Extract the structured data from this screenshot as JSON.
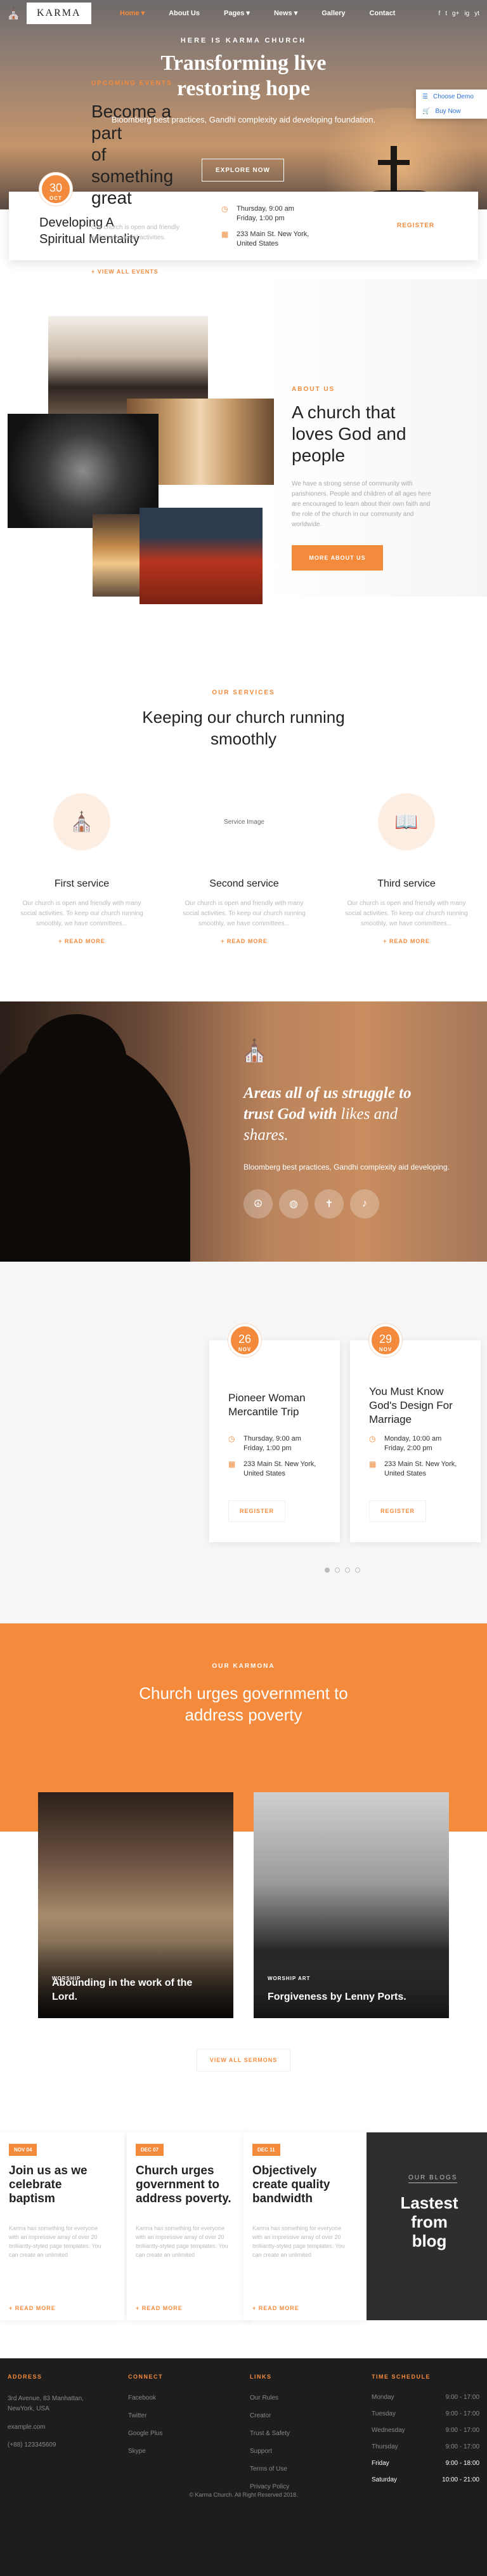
{
  "header": {
    "logo_text": "KARMA",
    "menu": [
      {
        "label": "Home",
        "dropdown": true,
        "active": true
      },
      {
        "label": "About Us",
        "dropdown": false,
        "active": false
      },
      {
        "label": "Pages",
        "dropdown": true,
        "active": false
      },
      {
        "label": "News",
        "dropdown": true,
        "active": false
      },
      {
        "label": "Gallery",
        "dropdown": false,
        "active": false
      },
      {
        "label": "Contact",
        "dropdown": false,
        "active": false
      }
    ],
    "social": [
      "f",
      "t",
      "g+",
      "ig",
      "yt"
    ]
  },
  "hero": {
    "kicker": "HERE IS KARMA CHURCH",
    "title_line1": "Transforming live",
    "title_line2": "restoring hope",
    "subtitle": "Bloomberg best practices, Gandhi complexity aid developing foundation.",
    "button": "EXPLORE NOW"
  },
  "demo_panel": {
    "choose": "Choose Demo",
    "buy": "Buy Now"
  },
  "featured_event": {
    "day": "30",
    "month": "OCT",
    "title_line1": "Developing A",
    "title_line2": "Spiritual Mentality",
    "date_line1": "Thursday, 9:00 am",
    "date_line2": "Friday, 1:00 pm",
    "address_line1": "233 Main St. New York,",
    "address_line2": "United States",
    "register": "REGISTER"
  },
  "about": {
    "kicker": "ABOUT US",
    "title_line1": "A church that",
    "title_line2": "loves God and",
    "title_line3": "people",
    "text": "We have a strong sense of community with parishioners. People and children of all ages here are encouraged to learn about their own faith and the role of the church in our community and worldwide.",
    "button": "MORE ABOUT US"
  },
  "services": {
    "kicker": "OUR SERVICES",
    "title_line1": "Keeping our church running",
    "title_line2": "smoothly",
    "items": [
      {
        "title": "First service",
        "text": "Our church is open and friendly with many social activities. To keep our church running smoothly, we have committees...",
        "more": "+ READ MORE",
        "icon": "church-icon"
      },
      {
        "title": "Second service",
        "text": "Our church is open and friendly with many social activities. To keep our church running smoothly, we have committees...",
        "more": "+ READ MORE",
        "image_alt": "Service Image"
      },
      {
        "title": "Third service",
        "text": "Our church is open and friendly with many social activities. To keep our church running smoothly, we have committees...",
        "more": "+ READ MORE",
        "icon": "book-icon"
      }
    ]
  },
  "quote": {
    "line1": "Areas all of us struggle to",
    "line2": "trust God with ",
    "line2_em": "likes and",
    "line3_em": "shares.",
    "subtitle": "Bloomberg best practices, Gandhi complexity aid developing."
  },
  "upcoming": {
    "kicker": "UPCOMING EVENTS",
    "title_line1": "Become a",
    "title_line2": "part",
    "title_line3": "of",
    "title_line4": "something",
    "title_line5": "great",
    "text": "Our church is open and friendly with many social activities.",
    "more": "+ VIEW ALL EVENTS",
    "events": [
      {
        "day": "26",
        "month": "NOV",
        "title": "Pioneer Woman Mercantile Trip",
        "date_line1": "Thursday, 9:00 am",
        "date_line2": "Friday, 1:00 pm",
        "address_line1": "233 Main St. New York,",
        "address_line2": "United States",
        "register": "REGISTER"
      },
      {
        "day": "29",
        "month": "NOV",
        "title": "You Must Know God's Design For Marriage",
        "date_line1": "Monday, 10:00 am",
        "date_line2": "Friday, 2:00 pm",
        "address_line1": "233 Main St. New York,",
        "address_line2": "United States",
        "register": "REGISTER"
      }
    ]
  },
  "sermons": {
    "kicker": "OUR KARMONA",
    "title_line1": "Church urges government to",
    "title_line2": "address poverty",
    "items": [
      {
        "category": "WORSHIP",
        "title": "Abounding in the work of the Lord."
      },
      {
        "category": "WORSHIP ART",
        "title": "Forgiveness by Lenny Ports."
      }
    ],
    "view_all": "VIEW ALL SERMONS"
  },
  "blog": {
    "kicker": "OUR BLOGS",
    "title_line1": "Lastest",
    "title_line2": "from",
    "title_line3": "blog",
    "posts": [
      {
        "tag": "NOV 04",
        "title": "Join us as we celebrate baptism",
        "text": "Karma has something for everyone with an impressive array of over 20 brilliantly-styled page templates. You can create an unlimited",
        "more": "+ READ MORE"
      },
      {
        "tag": "DEC 07",
        "title": "Church urges government to address poverty.",
        "text": "Karma has something for everyone with an impressive array of over 20 brilliantly-styled page templates. You can create an unlimited",
        "more": "+ READ MORE"
      },
      {
        "tag": "DEC 11",
        "title": "Objectively create quality bandwidth",
        "text": "Karma has something for everyone with an impressive array of over 20 brilliantly-styled page templates. You can create an unlimited",
        "more": "+ READ MORE"
      }
    ]
  },
  "footer": {
    "address_heading": "ADDRESS",
    "address_line1": "3rd Avenue, 83 Manhattan,",
    "address_line2": "NewYork, USA",
    "email": "example.com",
    "phone": "(+88) 123345609",
    "connect_heading": "CONNECT",
    "connect": [
      "Facebook",
      "Twitter",
      "Google Plus",
      "Skype"
    ],
    "links_heading": "LINKS",
    "links": [
      "Our Rules",
      "Creator",
      "Trust & Safety",
      "Support",
      "Terms of Use",
      "Privacy Policy"
    ],
    "schedule_heading": "TIME SCHEDULE",
    "schedule": [
      {
        "day": "Monday",
        "time": "9:00 - 17:00"
      },
      {
        "day": "Tuesday",
        "time": "9:00 - 17:00"
      },
      {
        "day": "Wednesday",
        "time": "9:00 - 17:00"
      },
      {
        "day": "Thursday",
        "time": "9:00 - 17:00"
      },
      {
        "day": "Friday",
        "time": "9:00 - 18:00"
      },
      {
        "day": "Saturday",
        "time": "10:00 - 21:00"
      }
    ],
    "copyright": "© Karma Church. All Right Reserved 2018."
  },
  "colors": {
    "accent": "#f48a3c",
    "dark": "#1d1d1d"
  }
}
